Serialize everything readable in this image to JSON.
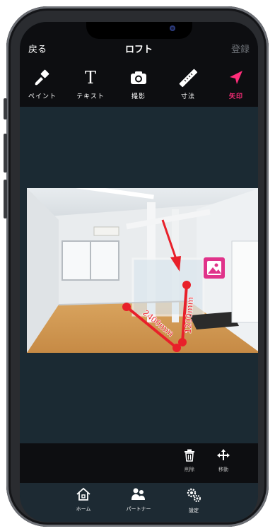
{
  "header": {
    "back_label": "戻る",
    "title": "ロフト",
    "register_label": "登録"
  },
  "tools": [
    {
      "label": "ペイント",
      "icon": "brush-icon"
    },
    {
      "label": "テキスト",
      "icon": "text-icon"
    },
    {
      "label": "撮影",
      "icon": "camera-icon"
    },
    {
      "label": "寸法",
      "icon": "ruler-icon"
    },
    {
      "label": "矢印",
      "icon": "arrow-icon",
      "active": true
    }
  ],
  "annotations": {
    "horizontal_dimension": "2400mm",
    "vertical_dimension": "1200mm",
    "accent_color": "#e8202a"
  },
  "actions": {
    "delete_label": "削除",
    "move_label": "移動"
  },
  "tabs": [
    {
      "label": "ホーム",
      "icon": "home-icon"
    },
    {
      "label": "パートナー",
      "icon": "partner-icon"
    },
    {
      "label": "設定",
      "icon": "settings-icon"
    }
  ],
  "colors": {
    "active": "#ff2d7a",
    "toolbar_bg": "#0d0e11",
    "canvas_bg": "#1b2a33"
  }
}
